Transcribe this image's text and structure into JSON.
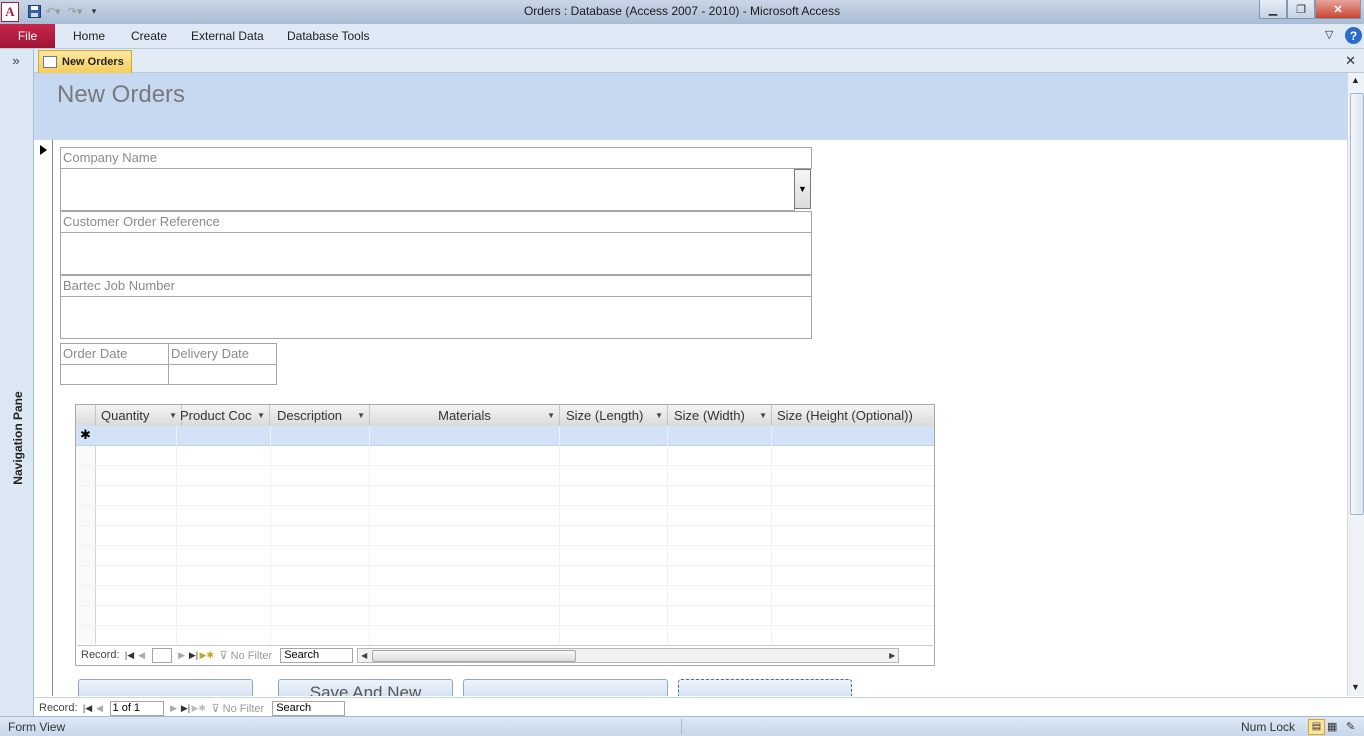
{
  "window": {
    "title": "Orders : Database (Access 2007 - 2010)  -  Microsoft Access",
    "app_icon_letter": "A"
  },
  "ribbon": {
    "file_label": "File",
    "tabs": [
      "Home",
      "Create",
      "External Data",
      "Database Tools"
    ],
    "help_glyph": "?"
  },
  "nav_pane": {
    "label": "Navigation Pane",
    "toggle_glyph": "»"
  },
  "document_tab": {
    "label": "New Orders",
    "close_glyph": "✕"
  },
  "form": {
    "title": "New Orders",
    "fields": {
      "company_name": {
        "label": "Company Name",
        "value": ""
      },
      "customer_order_reference": {
        "label": "Customer Order Reference",
        "value": ""
      },
      "bartec_job_number": {
        "label": "Bartec Job Number",
        "value": ""
      },
      "order_date": {
        "label": "Order Date",
        "value": ""
      },
      "delivery_date": {
        "label": "Delivery Date",
        "value": ""
      }
    }
  },
  "subform": {
    "columns": [
      "Quantity",
      "Product Coc",
      "Description",
      "Materials",
      "Size (Length)",
      "Size (Width)",
      "Size (Height (Optional))"
    ],
    "new_row_marker": "✱",
    "nav": {
      "record_label": "Record:",
      "record_value": "",
      "filter_label": "No Filter",
      "search_label": "Search"
    }
  },
  "buttons": {
    "save_and_new": "Save And New"
  },
  "main_nav": {
    "record_label": "Record:",
    "record_value": "1 of 1",
    "filter_label": "No Filter",
    "search_label": "Search"
  },
  "status_bar": {
    "view": "Form View",
    "num_lock": "Num Lock"
  },
  "colors": {
    "file_tab": "#a01436",
    "form_header": "#c6d9f1",
    "document_tab": "#f7cd5a",
    "new_row": "#d3e3f7"
  }
}
